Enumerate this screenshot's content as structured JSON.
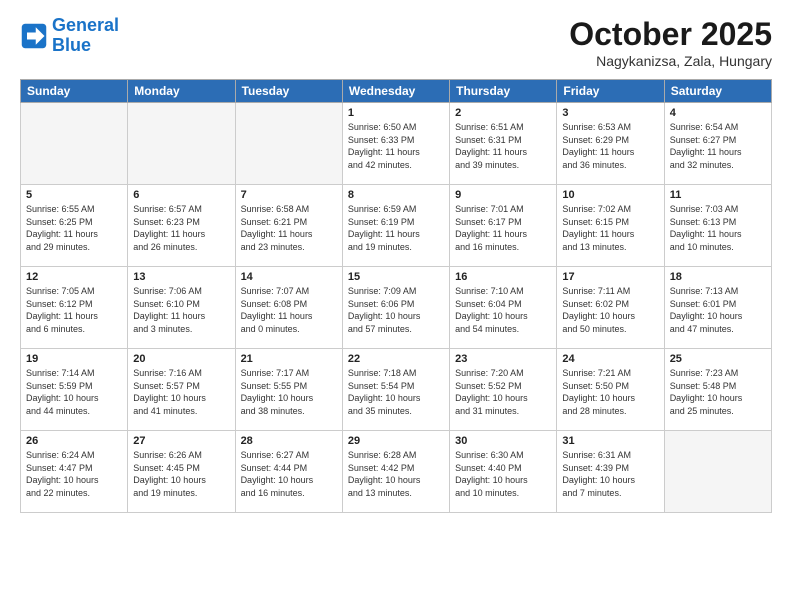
{
  "header": {
    "logo_line1": "General",
    "logo_line2": "Blue",
    "month": "October 2025",
    "location": "Nagykanizsa, Zala, Hungary"
  },
  "weekdays": [
    "Sunday",
    "Monday",
    "Tuesday",
    "Wednesday",
    "Thursday",
    "Friday",
    "Saturday"
  ],
  "weeks": [
    [
      {
        "day": "",
        "info": ""
      },
      {
        "day": "",
        "info": ""
      },
      {
        "day": "",
        "info": ""
      },
      {
        "day": "1",
        "info": "Sunrise: 6:50 AM\nSunset: 6:33 PM\nDaylight: 11 hours\nand 42 minutes."
      },
      {
        "day": "2",
        "info": "Sunrise: 6:51 AM\nSunset: 6:31 PM\nDaylight: 11 hours\nand 39 minutes."
      },
      {
        "day": "3",
        "info": "Sunrise: 6:53 AM\nSunset: 6:29 PM\nDaylight: 11 hours\nand 36 minutes."
      },
      {
        "day": "4",
        "info": "Sunrise: 6:54 AM\nSunset: 6:27 PM\nDaylight: 11 hours\nand 32 minutes."
      }
    ],
    [
      {
        "day": "5",
        "info": "Sunrise: 6:55 AM\nSunset: 6:25 PM\nDaylight: 11 hours\nand 29 minutes."
      },
      {
        "day": "6",
        "info": "Sunrise: 6:57 AM\nSunset: 6:23 PM\nDaylight: 11 hours\nand 26 minutes."
      },
      {
        "day": "7",
        "info": "Sunrise: 6:58 AM\nSunset: 6:21 PM\nDaylight: 11 hours\nand 23 minutes."
      },
      {
        "day": "8",
        "info": "Sunrise: 6:59 AM\nSunset: 6:19 PM\nDaylight: 11 hours\nand 19 minutes."
      },
      {
        "day": "9",
        "info": "Sunrise: 7:01 AM\nSunset: 6:17 PM\nDaylight: 11 hours\nand 16 minutes."
      },
      {
        "day": "10",
        "info": "Sunrise: 7:02 AM\nSunset: 6:15 PM\nDaylight: 11 hours\nand 13 minutes."
      },
      {
        "day": "11",
        "info": "Sunrise: 7:03 AM\nSunset: 6:13 PM\nDaylight: 11 hours\nand 10 minutes."
      }
    ],
    [
      {
        "day": "12",
        "info": "Sunrise: 7:05 AM\nSunset: 6:12 PM\nDaylight: 11 hours\nand 6 minutes."
      },
      {
        "day": "13",
        "info": "Sunrise: 7:06 AM\nSunset: 6:10 PM\nDaylight: 11 hours\nand 3 minutes."
      },
      {
        "day": "14",
        "info": "Sunrise: 7:07 AM\nSunset: 6:08 PM\nDaylight: 11 hours\nand 0 minutes."
      },
      {
        "day": "15",
        "info": "Sunrise: 7:09 AM\nSunset: 6:06 PM\nDaylight: 10 hours\nand 57 minutes."
      },
      {
        "day": "16",
        "info": "Sunrise: 7:10 AM\nSunset: 6:04 PM\nDaylight: 10 hours\nand 54 minutes."
      },
      {
        "day": "17",
        "info": "Sunrise: 7:11 AM\nSunset: 6:02 PM\nDaylight: 10 hours\nand 50 minutes."
      },
      {
        "day": "18",
        "info": "Sunrise: 7:13 AM\nSunset: 6:01 PM\nDaylight: 10 hours\nand 47 minutes."
      }
    ],
    [
      {
        "day": "19",
        "info": "Sunrise: 7:14 AM\nSunset: 5:59 PM\nDaylight: 10 hours\nand 44 minutes."
      },
      {
        "day": "20",
        "info": "Sunrise: 7:16 AM\nSunset: 5:57 PM\nDaylight: 10 hours\nand 41 minutes."
      },
      {
        "day": "21",
        "info": "Sunrise: 7:17 AM\nSunset: 5:55 PM\nDaylight: 10 hours\nand 38 minutes."
      },
      {
        "day": "22",
        "info": "Sunrise: 7:18 AM\nSunset: 5:54 PM\nDaylight: 10 hours\nand 35 minutes."
      },
      {
        "day": "23",
        "info": "Sunrise: 7:20 AM\nSunset: 5:52 PM\nDaylight: 10 hours\nand 31 minutes."
      },
      {
        "day": "24",
        "info": "Sunrise: 7:21 AM\nSunset: 5:50 PM\nDaylight: 10 hours\nand 28 minutes."
      },
      {
        "day": "25",
        "info": "Sunrise: 7:23 AM\nSunset: 5:48 PM\nDaylight: 10 hours\nand 25 minutes."
      }
    ],
    [
      {
        "day": "26",
        "info": "Sunrise: 6:24 AM\nSunset: 4:47 PM\nDaylight: 10 hours\nand 22 minutes."
      },
      {
        "day": "27",
        "info": "Sunrise: 6:26 AM\nSunset: 4:45 PM\nDaylight: 10 hours\nand 19 minutes."
      },
      {
        "day": "28",
        "info": "Sunrise: 6:27 AM\nSunset: 4:44 PM\nDaylight: 10 hours\nand 16 minutes."
      },
      {
        "day": "29",
        "info": "Sunrise: 6:28 AM\nSunset: 4:42 PM\nDaylight: 10 hours\nand 13 minutes."
      },
      {
        "day": "30",
        "info": "Sunrise: 6:30 AM\nSunset: 4:40 PM\nDaylight: 10 hours\nand 10 minutes."
      },
      {
        "day": "31",
        "info": "Sunrise: 6:31 AM\nSunset: 4:39 PM\nDaylight: 10 hours\nand 7 minutes."
      },
      {
        "day": "",
        "info": ""
      }
    ]
  ]
}
